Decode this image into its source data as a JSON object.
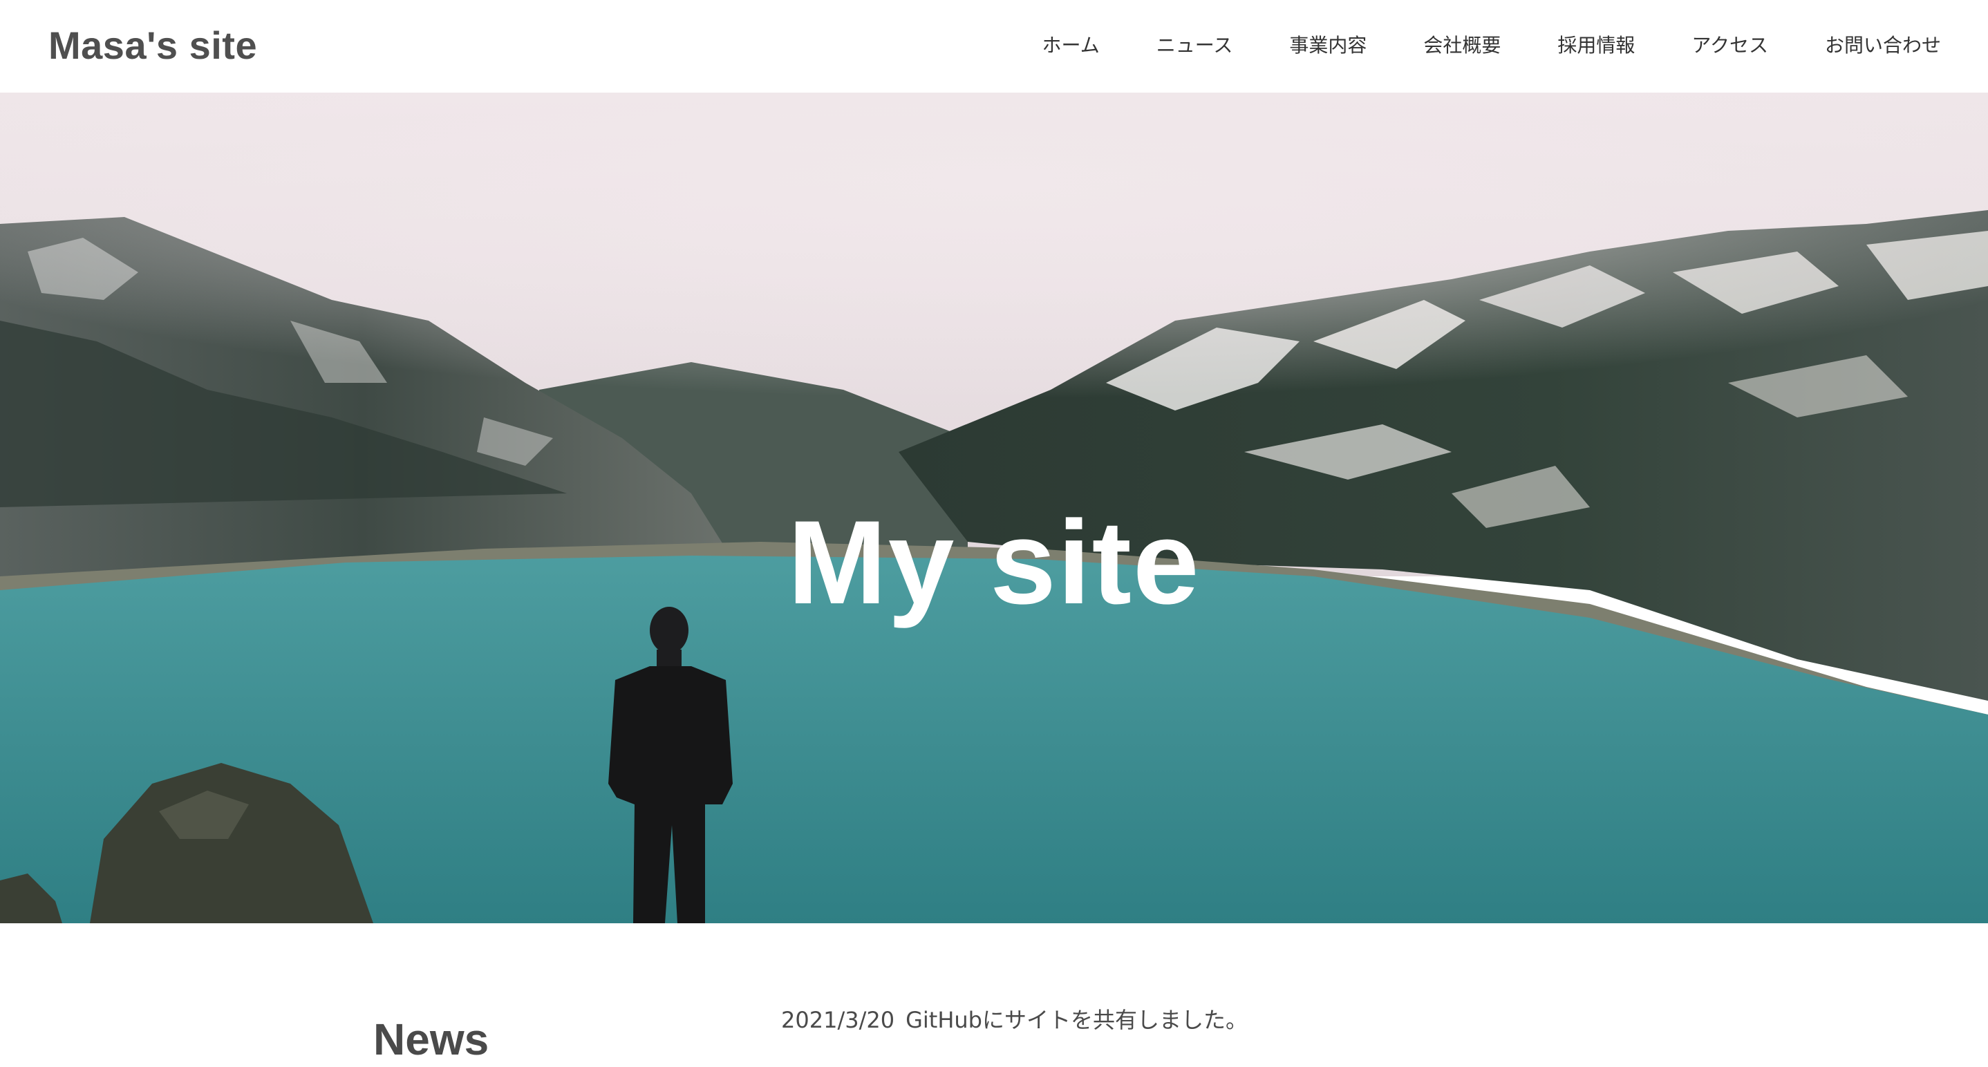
{
  "header": {
    "logo": "Masa's site",
    "nav": [
      "ホーム",
      "ニュース",
      "事業内容",
      "会社概要",
      "採用情報",
      "アクセス",
      "お問い合わせ"
    ]
  },
  "hero": {
    "title": "My site",
    "image_description": "mountain-lake-photo"
  },
  "news": {
    "heading": "News",
    "items": [
      {
        "date": "2021/3/20",
        "text": "GitHubにサイトを共有しました。"
      }
    ]
  },
  "colors": {
    "header_bg": "#ffffff",
    "logo_text": "#4f4f4f",
    "nav_text": "#333333",
    "hero_title": "#ffffff",
    "lake": "#3f8e92",
    "sky": "#ece2e6"
  }
}
